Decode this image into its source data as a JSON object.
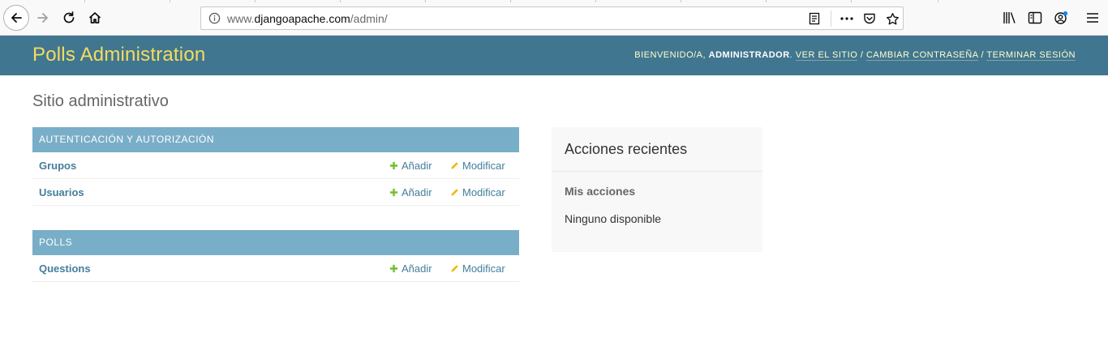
{
  "browser": {
    "url_prefix": "www.",
    "url_host": "djangoapache.com",
    "url_path": "/admin/",
    "icons": {
      "back": "back-arrow-icon",
      "forward": "forward-arrow-icon",
      "reload": "reload-icon",
      "home": "home-icon",
      "info": "info-icon",
      "reader": "reader-view-icon",
      "more": "more-dots-icon",
      "pocket": "pocket-icon",
      "bookmark": "star-icon",
      "library": "library-icon",
      "sidebar": "sidebar-icon",
      "account": "account-icon",
      "menu": "hamburger-menu-icon"
    }
  },
  "header": {
    "branding": "Polls Administration",
    "welcome": "Bienvenido/a,",
    "username": "administrador",
    "link_view_site": "Ver el sitio",
    "link_change_password": "Cambiar contraseña",
    "link_logout": "Terminar sesión",
    "separator": "/",
    "colors": {
      "header_bg": "#417690",
      "branding": "#f5dd5d",
      "caption_bg": "#79aec8",
      "link": "#447e9b"
    }
  },
  "content": {
    "title": "Sitio administrativo",
    "modules": [
      {
        "caption": "Autenticación y autorización",
        "models": [
          {
            "name": "Grupos",
            "add": "Añadir",
            "change": "Modificar"
          },
          {
            "name": "Usuarios",
            "add": "Añadir",
            "change": "Modificar"
          }
        ]
      },
      {
        "caption": "Polls",
        "models": [
          {
            "name": "Questions",
            "add": "Añadir",
            "change": "Modificar"
          }
        ]
      }
    ]
  },
  "recent_actions": {
    "title": "Acciones recientes",
    "subtitle": "Mis acciones",
    "empty": "Ninguno disponible"
  }
}
